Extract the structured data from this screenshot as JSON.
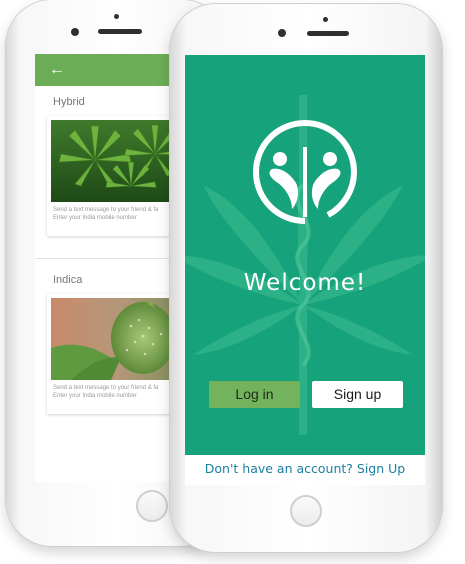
{
  "back_screen": {
    "back_icon": "arrow-left-icon",
    "sections": [
      {
        "title": "Hybrid",
        "image": "cannabis-plant-hybrid",
        "line1": "Send a text message to your friend & fa",
        "line2": "Enter your India mobile number"
      },
      {
        "title": "Indica",
        "image": "cannabis-bud-indica",
        "line1": "Send a text message to your friend & fa",
        "line2": "Enter your India mobile number"
      }
    ]
  },
  "front_screen": {
    "logo_icon": "two-people-caduceus-logo-icon",
    "welcome_text": "Welcome!",
    "login_label": "Log in",
    "signup_label": "Sign up",
    "footer_text": "Don't have an account? Sign Up"
  },
  "colors": {
    "brand_green": "#16a37c",
    "appbar_green": "#6cae58",
    "login_button": "#74b35e",
    "footer_link": "#1a7fa0"
  }
}
